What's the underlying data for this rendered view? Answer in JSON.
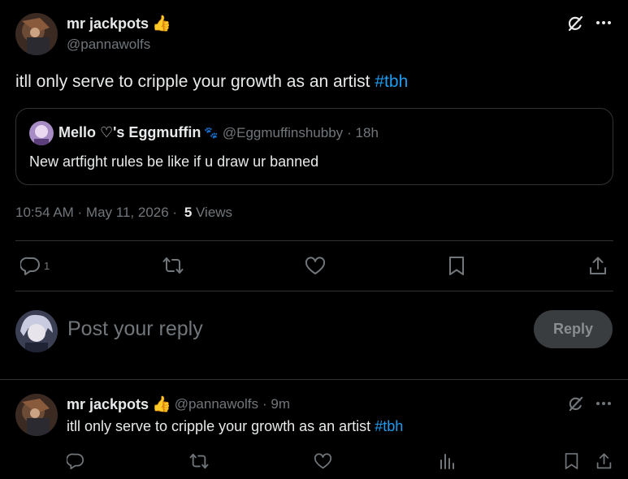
{
  "main_tweet": {
    "author_name": "mr jackpots",
    "author_emoji": "👍",
    "author_handle": "@pannawolfs",
    "text": "itll only serve to cripple your growth as an artist",
    "hashtag": "#tbh",
    "quote": {
      "author_name": "Mello ♡'s Eggmuffin",
      "author_emoji": "🐾",
      "author_handle": "@Eggmuffinshubby",
      "time": "· 18h",
      "text": "New artfight rules be like if u draw ur banned"
    },
    "timestamp": "10:54 AM · May 11, 2026 ·",
    "views_count": "5",
    "views_label": "Views",
    "reply_count": "1"
  },
  "reply_box": {
    "placeholder": "Post your reply",
    "button_label": "Reply"
  },
  "reply_tweet": {
    "author_name": "mr jackpots",
    "author_emoji": "👍",
    "author_handle": "@pannawolfs",
    "time": "· 9m",
    "text": "itll only serve to cripple your growth as an artist",
    "hashtag": "#tbh"
  },
  "colors": {
    "background": "#000000",
    "text": "#e7e9ea",
    "muted": "#71767b",
    "link": "#1d9bf0",
    "border": "#2f3336"
  },
  "icons": [
    "grok-icon",
    "more-icon",
    "reply-icon",
    "retweet-icon",
    "like-icon",
    "bookmark-icon",
    "share-icon",
    "analytics-icon"
  ]
}
